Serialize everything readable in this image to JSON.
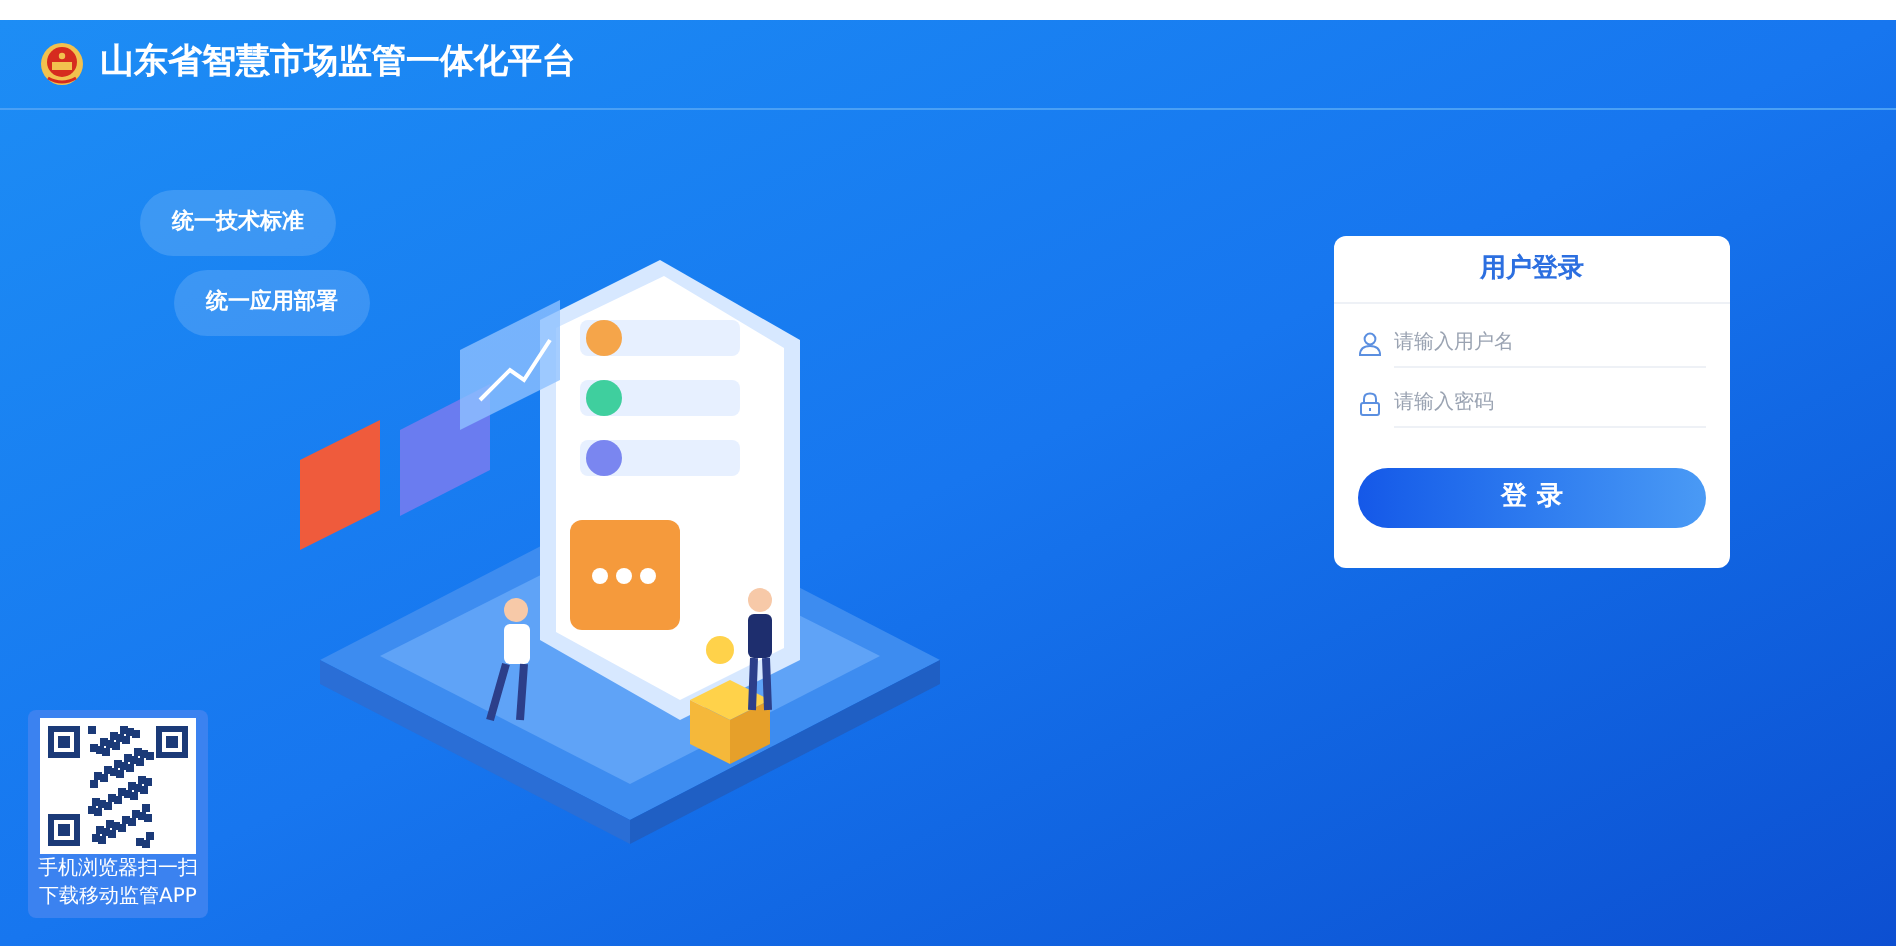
{
  "header": {
    "title": "山东省智慧市场监管一体化平台"
  },
  "features": [
    "统一技术标准",
    "统一应用部署"
  ],
  "login": {
    "title": "用户登录",
    "fields": [
      {
        "kind": "user",
        "placeholder": "请输入用户名"
      },
      {
        "kind": "password",
        "placeholder": "请输入密码"
      }
    ],
    "button": "登 录"
  },
  "qr": {
    "lines": [
      "手机浏览器扫一扫",
      "下载移动监管APP"
    ]
  }
}
